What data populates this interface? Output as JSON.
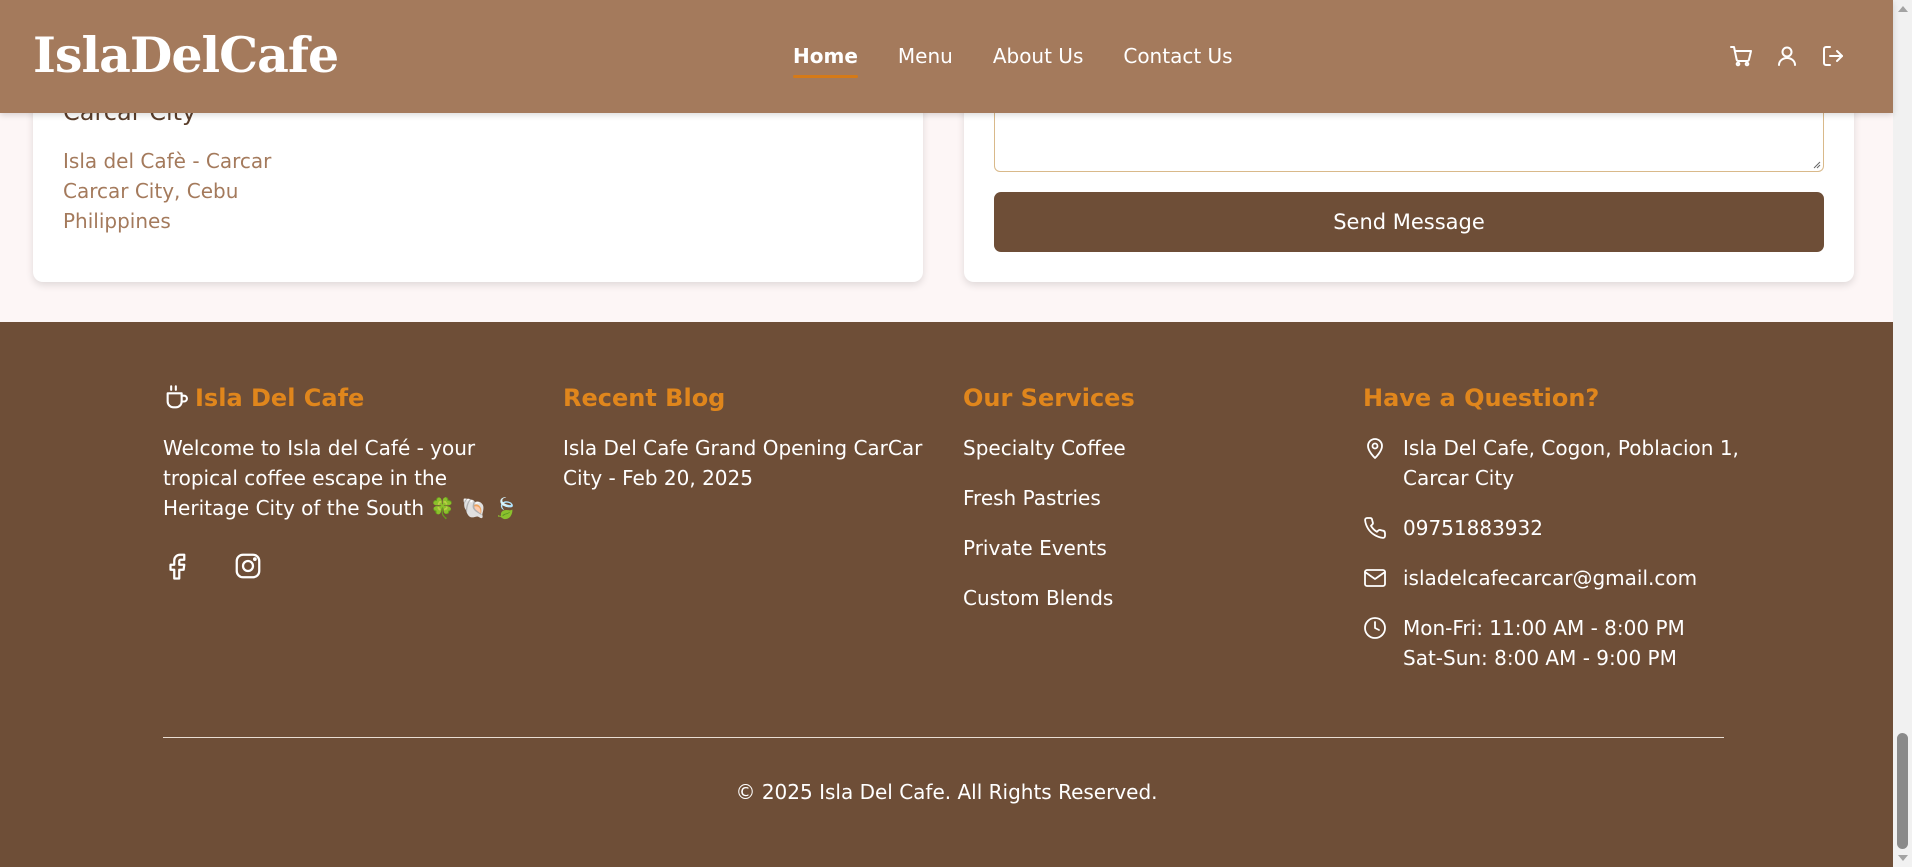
{
  "header": {
    "logo": "IslaDelCafe",
    "nav": [
      "Home",
      "Menu",
      "About Us",
      "Contact Us"
    ],
    "icons": [
      "cart-icon",
      "user-icon",
      "logout-icon"
    ]
  },
  "contact_card": {
    "city": "Carcar City",
    "address_lines": [
      "Isla del Cafè - Carcar",
      "Carcar City, Cebu",
      "Philippines"
    ],
    "send_button": "Send Message"
  },
  "footer": {
    "brand": "Isla Del Cafe",
    "about": "Welcome to Isla del Café - your tropical coffee escape in the Heritage City of the South 🍀 🐚 🍃",
    "recent_blog_title": "Recent Blog",
    "recent_blog_entry": "Isla Del Cafe Grand Opening CarCar City - Feb 20, 2025",
    "services_title": "Our Services",
    "services": [
      "Specialty Coffee",
      "Fresh Pastries",
      "Private Events",
      "Custom Blends"
    ],
    "question_title": "Have a Question?",
    "address": "Isla Del Cafe, Cogon, Poblacion 1, Carcar City",
    "phone": "09751883932",
    "email": "isladelcafecarcar@gmail.com",
    "hours_weekday": "Mon-Fri: 11:00 AM - 8:00 PM",
    "hours_weekend": "Sat-Sun: 8:00 AM - 9:00 PM",
    "copyright": "© 2025 Isla Del Cafe. All Rights Reserved."
  },
  "colors": {
    "header_bg": "#a47a5c",
    "footer_bg": "#6e4e37",
    "accent": "#e0861c",
    "button_bg": "#6e4e37"
  }
}
